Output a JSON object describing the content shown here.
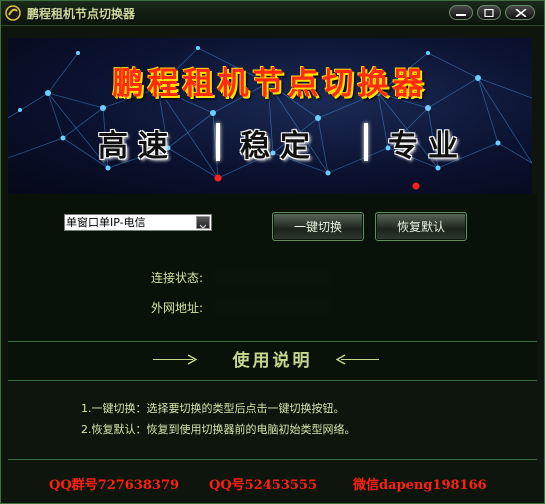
{
  "window": {
    "title": "鹏程租机节点切换器"
  },
  "banner": {
    "title": "鹏程租机节点切换器",
    "slogans": [
      "高速",
      "稳定",
      "专业"
    ]
  },
  "controls": {
    "node_select_value": "单窗口单IP-电信",
    "switch_button": "一键切换",
    "restore_button": "恢复默认"
  },
  "status": {
    "connection_label": "连接状态:",
    "external_ip_label": "外网地址:"
  },
  "usage": {
    "heading": "使用说明",
    "items": [
      "1.一键切换：选择要切换的类型后点击一键切换按钮。",
      "2.恢复默认：恢复到使用切换器前的电脑初始类型网络。"
    ]
  },
  "footer": {
    "qq_group": "QQ群号727638379",
    "qq": "QQ号52453555",
    "wechat": "微信dapeng198166"
  },
  "colors": {
    "accent_text": "#d2e4a0",
    "footer_red": "#ff2010",
    "banner_bg": "#0b1230"
  }
}
